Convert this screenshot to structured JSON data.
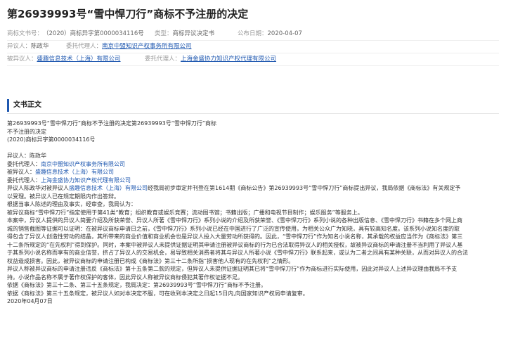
{
  "document": {
    "title": "第26939993号“雪中悍刀行”商标不予注册的决定"
  },
  "meta": {
    "doc_no_label": "商标文书号：",
    "doc_no_value": "（2020）商标异字第0000034116号",
    "type_label": "类型：",
    "type_value": "商标异议决定书",
    "date_label": "公布日期：",
    "date_value": "2020-04-07",
    "opponent_label": "异议人：",
    "opponent_value": "陈政华",
    "opponent_agent_label": "委托代理人：",
    "opponent_agent_value": "南京中盟知识产权事务所有限公司",
    "respondent_label": "被异议人：",
    "respondent_value": "盛趣信息技术（上海）有限公司",
    "respondent_agent_label": "委托代理人：",
    "respondent_agent_value": "上海金盛协力知识产权代理有限公司"
  },
  "section": {
    "title": "文书正文"
  },
  "body": {
    "l1": "第26939993号“雪中悍刀行”商标不予注册的决定第26939993号“雪中悍刀行”商标",
    "l2": "不予注册的决定",
    "l3": "(2020)商标异字第0000034116号",
    "l4": "异议人：陈政华",
    "l5_a": "委托代理人：",
    "l5_b": "南京中盟知识产权事务所有限公司",
    "l6_a": "被异议人：",
    "l6_b": "盛趣信息技术（上海）有限公司",
    "l7_a": "委托代理人：",
    "l7_b": "上海金盛协力知识产权代理有限公司",
    "l8_a": "异议人陈政华对被异议人",
    "l8_b": "盛趣信息技术（上海）有限公司",
    "l8_c": "经我局初步审定并刊登在第1614期《商标公告》第26939993号“雪中悍刀行”商标提出异议，我局依据《商标法》有关规定予",
    "l9": "以受理。被异议人已在规定期限内作出答辩。",
    "l10": "根据当事人陈述的理由及事实，经审查，我局认为：",
    "l11": "被异议商标“雪中悍刀行”指定使用于第41类“教育；组织教育或娱乐竞赛；流动图书馆；书籍出版；广播和电视节目制作；娱乐服务”等服务上。",
    "l12": "本案中，异议人提供的异议人简要介绍及所获荣誉、异议人所著《雪中悍刀行》系列小说的介绍及所获荣誉、《雪中悍刀行》系列小说的各种出版信息、《雪中悍刀行》书籍在多个网上商",
    "l13": "城的销售截图等证据可以证明：在被异议商标申请日之前，《雪中悍刀行》系列小说已经在中国进行了广泛的宣传使用，为相关公众广为知晓，具有较高知名度。该系列小说知名度的取",
    "l14": "得包含了异议人创造性劳动的结晶，其所带来的商业价值和商业机会也是异议人投入大量劳动所获得的。因此，“雪中悍刀行”作为知名小说名称，其承载的权益应当作为《商标法》第三",
    "l15": "十二条所规定的“在先权利”得到保护。同时，本案中被异议人未提供证据证明其申请注册被异议商标的行为已合法取得异议人的相关授权，故被异议商标的申请注册不当利用了异议人基",
    "l16": "于其系列小说名称而享有的商业信誉，挤占了异议人的交易机会，易导致相关消费者将其与异议人所著小说《雪中悍刀行》联系起来，或认为二者之间具有某种关联，从而对异议人的合法",
    "l17": "权益造成损害。因此，被异议商标的申请注册已构成《商标法》第三十二条所指“损害他人现有的在先权利”之情形。",
    "l18": "异议人称被异议商标的申请注册违反《商标法》第十五条第二款的规定，但异议人未提供证据证明其已将“雪中悍刀行”作为商标进行实际使用，因此对异议人上述异议理由我局不予支",
    "l19": "持。小说作品名称不属于著作权保护的客体，因此异议人称被异议商标侵犯其著作权证据不足。",
    "l20": "依据《商标法》第三十二条、第三十五条规定，我局决定：第26939993号“雪中悍刀行”商标不予注册。",
    "l21": "依据《商标法》第三十五条规定，被异议人如对本决定不服，可在收到本决定之日起15日内,向国家知识产权局申请复审。",
    "l22": "2020年04月07日"
  },
  "colors": {
    "link": "#1f58b0",
    "accent": "#1f58b0"
  }
}
